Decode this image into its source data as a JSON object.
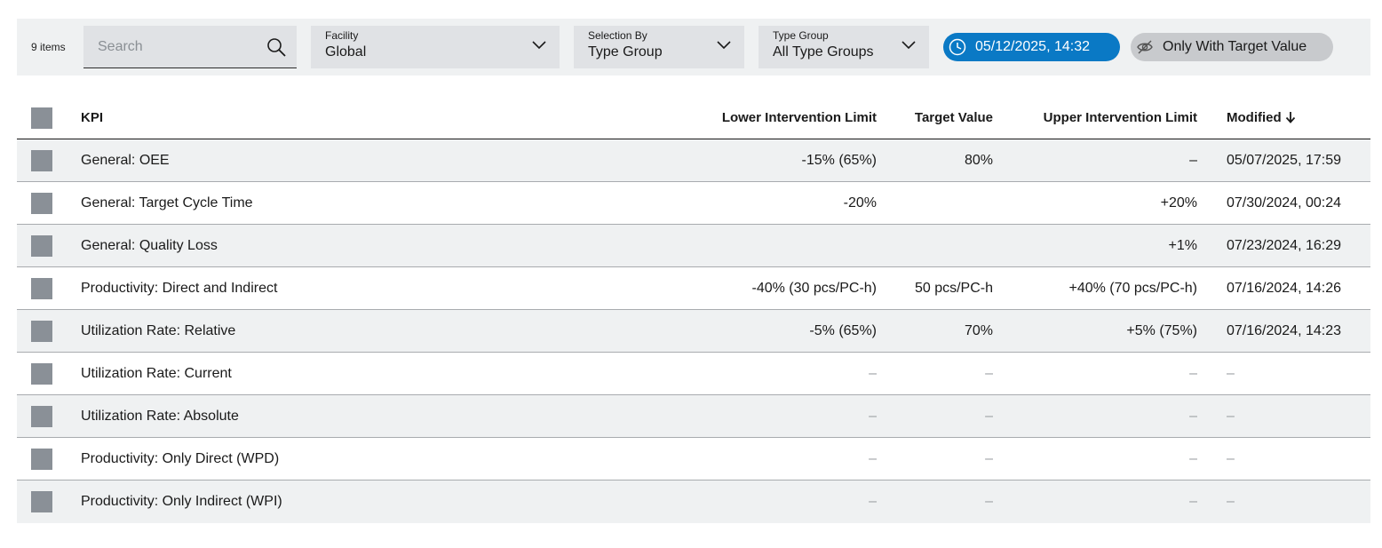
{
  "toolbar": {
    "item_count": "9 items",
    "search": {
      "placeholder": "Search"
    },
    "facility": {
      "label": "Facility",
      "value": "Global"
    },
    "selection_by": {
      "label": "Selection By",
      "value": "Type Group"
    },
    "type_group": {
      "label": "Type Group",
      "value": "All Type Groups"
    },
    "date_pill": "05/12/2025, 14:32",
    "target_pill": "Only With Target Value",
    "colors": {
      "accent": "#0a79c5",
      "toolbar_bg": "#eff1f2",
      "field_bg": "#e0e2e5"
    }
  },
  "table": {
    "headers": {
      "kpi": "KPI",
      "lower": "Lower Intervention Limit",
      "target": "Target Value",
      "upper": "Upper Intervention Limit",
      "modified": "Modified"
    },
    "rows": [
      {
        "kpi": "General: OEE",
        "lower": "-15% (65%)",
        "target": "80%",
        "upper": "–",
        "modified": "05/07/2025, 17:59"
      },
      {
        "kpi": "General: Target Cycle Time",
        "lower": "-20%",
        "target": "",
        "upper": "+20%",
        "modified": "07/30/2024, 00:24"
      },
      {
        "kpi": "General: Quality Loss",
        "lower": "",
        "target": "",
        "upper": "+1%",
        "modified": "07/23/2024, 16:29"
      },
      {
        "kpi": "Productivity: Direct and Indirect",
        "lower": "-40% (30 pcs/PC-h)",
        "target": "50 pcs/PC-h",
        "upper": "+40% (70 pcs/PC-h)",
        "modified": "07/16/2024, 14:26"
      },
      {
        "kpi": "Utilization Rate: Relative",
        "lower": "-5% (65%)",
        "target": "70%",
        "upper": "+5% (75%)",
        "modified": "07/16/2024, 14:23"
      },
      {
        "kpi": "Utilization Rate: Current",
        "lower": "–",
        "target": "–",
        "upper": "–",
        "modified": "–"
      },
      {
        "kpi": "Utilization Rate: Absolute",
        "lower": "–",
        "target": "–",
        "upper": "–",
        "modified": "–"
      },
      {
        "kpi": "Productivity: Only Direct (WPD)",
        "lower": "–",
        "target": "–",
        "upper": "–",
        "modified": "–"
      },
      {
        "kpi": "Productivity: Only Indirect (WPI)",
        "lower": "–",
        "target": "–",
        "upper": "–",
        "modified": "–"
      }
    ]
  }
}
